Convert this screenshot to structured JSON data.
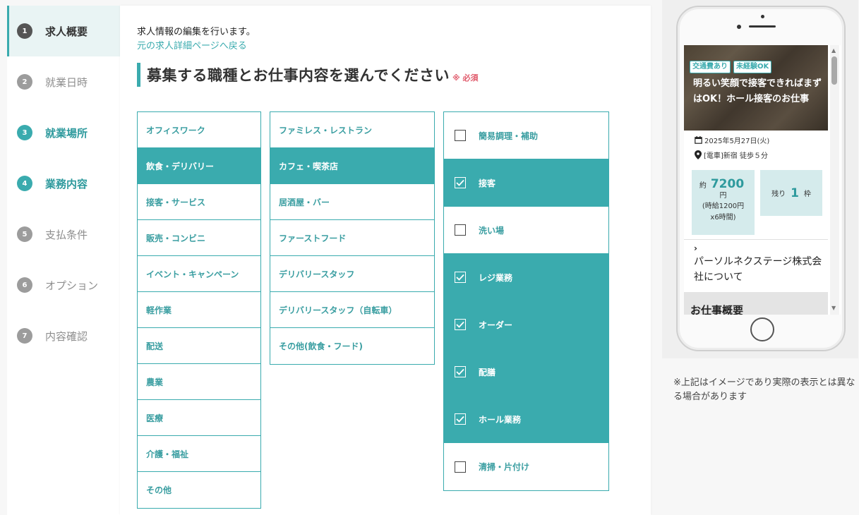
{
  "sidebar": {
    "steps": [
      {
        "num": "1",
        "label": "求人概要"
      },
      {
        "num": "2",
        "label": "就業日時"
      },
      {
        "num": "3",
        "label": "就業場所"
      },
      {
        "num": "4",
        "label": "業務内容"
      },
      {
        "num": "5",
        "label": "支払条件"
      },
      {
        "num": "6",
        "label": "オプション"
      },
      {
        "num": "7",
        "label": "内容確認"
      }
    ]
  },
  "main": {
    "intro": "求人情報の編集を行います。",
    "back_link": "元の求人詳細ページへ戻る",
    "heading": "募集する職種とお仕事内容を選んでください",
    "required": "※ 必須",
    "categories": [
      "オフィスワーク",
      "飲食・デリバリー",
      "接客・サービス",
      "販売・コンビニ",
      "イベント・キャンペーン",
      "軽作業",
      "配送",
      "農業",
      "医療",
      "介護・福祉",
      "その他"
    ],
    "subcategories": [
      "ファミレス・レストラン",
      "カフェ・喫茶店",
      "居酒屋・バー",
      "ファーストフード",
      "デリバリースタッフ",
      "デリバリースタッフ（自転車）",
      "その他(飲食・フード)"
    ],
    "tasks": [
      "簡易調理・補助",
      "接客",
      "洗い場",
      "レジ業務",
      "オーダー",
      "配膳",
      "ホール業務",
      "清掃・片付け"
    ]
  },
  "preview": {
    "tags": [
      "交通費あり",
      "未経験OK"
    ],
    "hero_title": "明るい笑顔で接客できればまずはOK！ホール接客のお仕事",
    "date": "2025年5月27日(火)",
    "place": "[電車]新宿 徒歩５分",
    "pay_prefix": "約",
    "pay_amount": "7200",
    "pay_unit": "円",
    "pay_detail1": "(時給1200円",
    "pay_detail2": "x6時間)",
    "remain_prefix": "残り",
    "remain_num": "1",
    "remain_unit": "枠",
    "company_chevron": "›",
    "company": "パーソルネクステージ株式会社について",
    "summary_title": "お仕事概要"
  },
  "note": "※上記はイメージであり実際の表示とは異なる場合があります",
  "colors": {
    "accent": "#3aabae",
    "required": "#e05a6b"
  }
}
